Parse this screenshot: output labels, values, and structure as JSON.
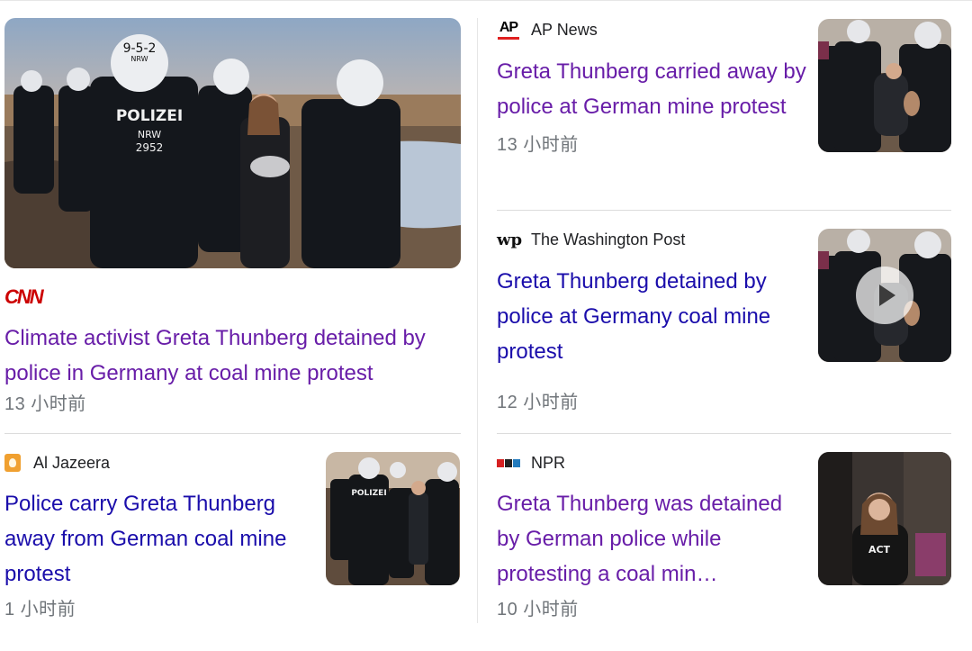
{
  "articles": [
    {
      "source": "CNN",
      "source_logo_text": "CNN",
      "headline": "Climate activist Greta Thunberg detained by police in Germany at coal mine protest",
      "time": "13 小时前",
      "visited": true,
      "image_text": {
        "helmet": "9-5-2",
        "helmet_sub": "NRW",
        "vest": "POLIZEI",
        "vest_sub": "NRW",
        "vest_num": "2952"
      }
    },
    {
      "source": "AP News",
      "source_logo_text": "AP",
      "headline": "Greta Thunberg carried away by police at German mine protest",
      "time": "13 小时前",
      "visited": true
    },
    {
      "source": "The Washington Post",
      "source_logo_text": "wp",
      "headline": "Greta Thunberg detained by police at Germany coal mine protest",
      "time": "12 小时前",
      "visited": false,
      "has_video": true
    },
    {
      "source": "Al Jazeera",
      "headline": "Police carry Greta Thunberg away from German coal mine protest",
      "time": "1 小时前",
      "visited": false,
      "image_text": {
        "vest": "POLIZEI"
      }
    },
    {
      "source": "NPR",
      "headline": "Greta Thunberg was detained by German police while protesting a coal min…",
      "time": "10 小时前",
      "visited": true,
      "image_text": {
        "shirt": "ACT"
      }
    }
  ],
  "colors": {
    "visited_link": "#681da8",
    "unvisited_link": "#1a0dab",
    "meta_text": "#70757a",
    "cnn_red": "#cc0000",
    "ap_red": "#e02020"
  },
  "icons": [
    "cnn-logo",
    "ap-logo",
    "washington-post-logo",
    "al-jazeera-logo",
    "npr-logo",
    "play-icon"
  ]
}
